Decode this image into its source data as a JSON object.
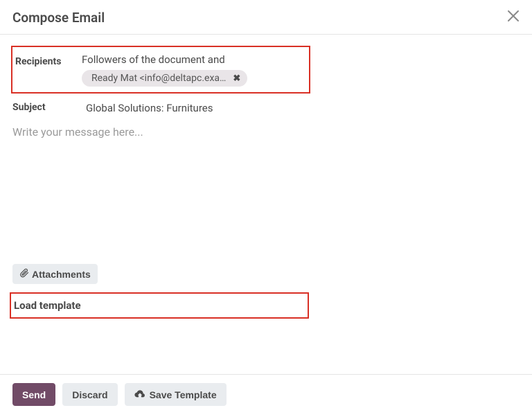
{
  "header": {
    "title": "Compose Email"
  },
  "labels": {
    "recipients": "Recipients",
    "subject": "Subject",
    "load_template": "Load template"
  },
  "recipients": {
    "intro_text": "Followers of the document and",
    "tags": [
      {
        "display": "Ready Mat <info@deltapc.exa…"
      }
    ]
  },
  "subject": {
    "value": "Global Solutions: Furnitures"
  },
  "message": {
    "placeholder": "Write your message here..."
  },
  "buttons": {
    "attachments": "Attachments",
    "send": "Send",
    "discard": "Discard",
    "save_template": "Save Template"
  }
}
